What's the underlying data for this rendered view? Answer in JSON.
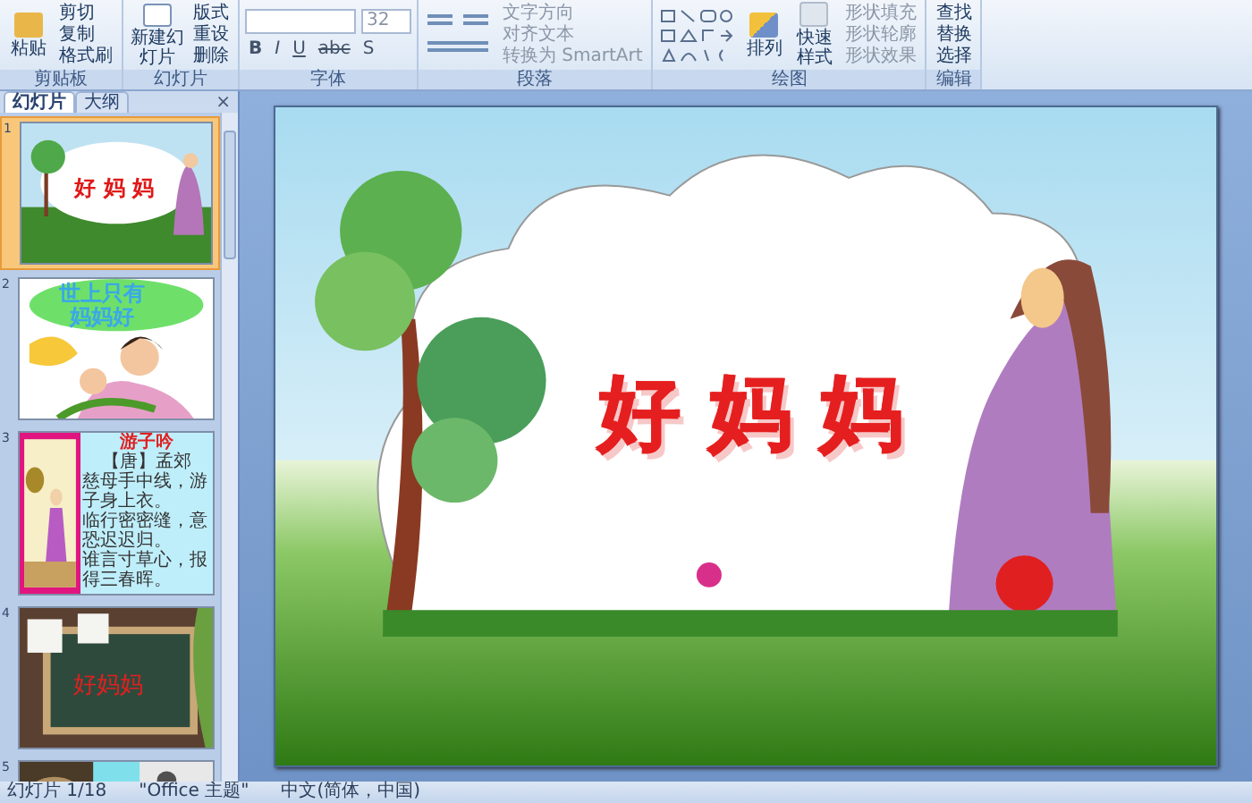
{
  "ribbon": {
    "clipboard": {
      "paste": "粘贴",
      "items": [
        "剪切",
        "复制",
        "格式刷"
      ],
      "label": "剪贴板"
    },
    "slides": {
      "new_slide": "新建幻灯片",
      "items": [
        "版式",
        "重设",
        "删除"
      ],
      "label": "幻灯片"
    },
    "font": {
      "size": "32",
      "formats": [
        "B",
        "I",
        "U",
        "abc",
        "S"
      ],
      "label": "字体"
    },
    "paragraph": {
      "items": [
        "文字方向",
        "对齐文本",
        "转换为 SmartArt"
      ],
      "label": "段落"
    },
    "drawing": {
      "arrange": "排列",
      "quick_styles": "快速样式",
      "items": [
        "形状填充",
        "形状轮廓",
        "形状效果"
      ],
      "label": "绘图"
    },
    "editing": {
      "items": [
        "查找",
        "替换",
        "选择"
      ],
      "label": "编辑"
    }
  },
  "pane": {
    "tabs": [
      {
        "label": "幻灯片",
        "selected": true
      },
      {
        "label": "大纲",
        "selected": false
      }
    ],
    "close": "×",
    "slides": [
      {
        "number": "1",
        "selected": true,
        "kind": "title",
        "lines": [
          "好 妈 妈"
        ]
      },
      {
        "number": "2",
        "selected": false,
        "kind": "cover",
        "lines": [
          "世上只有",
          "妈妈好"
        ]
      },
      {
        "number": "3",
        "selected": false,
        "kind": "poem",
        "lines": [
          "游子吟",
          "【唐】孟郊",
          "慈母手中线，游子身上衣。",
          "临行密密缝，意恐迟迟归。",
          "谁言寸草心，报得三春晖。"
        ]
      },
      {
        "number": "4",
        "selected": false,
        "kind": "chalkboard",
        "lines": [
          "好妈妈"
        ]
      },
      {
        "number": "5",
        "selected": false,
        "kind": "photos"
      }
    ]
  },
  "slide": {
    "title": "好 妈 妈"
  },
  "status_bar": [
    "幻灯片 1/18",
    "\"Office 主题\"",
    "中文(简体，中国)"
  ]
}
